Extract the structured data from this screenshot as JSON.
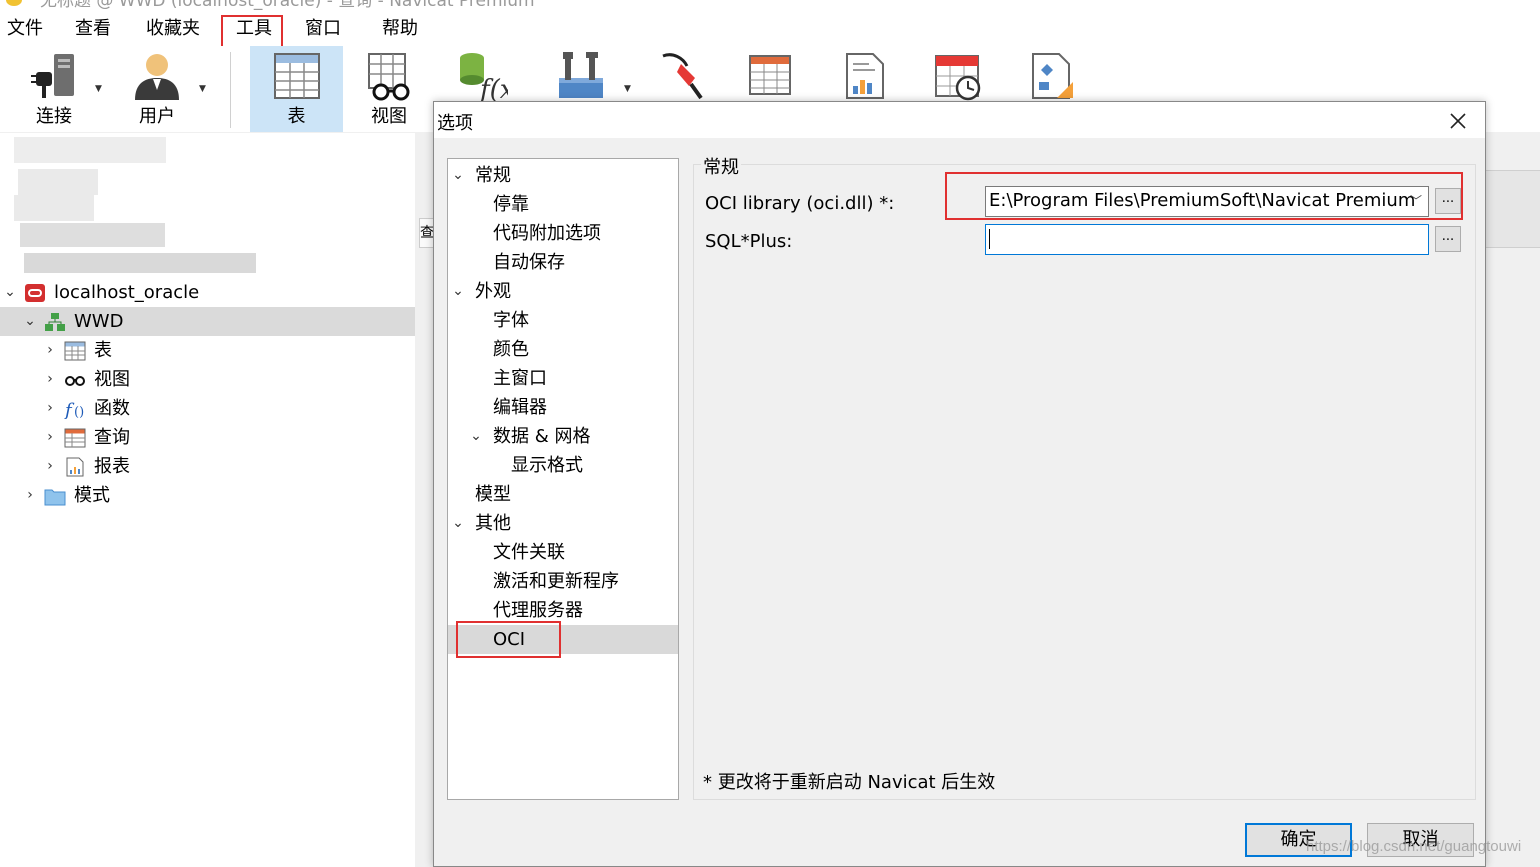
{
  "window": {
    "title": "无标题 @ WWD (localhost_oracle) - 查询 - Navicat Premium"
  },
  "menubar": {
    "items": [
      "文件",
      "查看",
      "收藏夹",
      "工具",
      "窗口",
      "帮助"
    ]
  },
  "toolbar": {
    "connect": "连接",
    "user": "用户",
    "table": "表",
    "view": "视图"
  },
  "navigator": {
    "connection": "localhost_oracle",
    "schema": "WWD",
    "children": [
      "表",
      "视图",
      "函数",
      "查询",
      "报表"
    ],
    "other": "模式"
  },
  "dialog": {
    "title": "选项",
    "tree": {
      "general": "常规",
      "dock": "停靠",
      "code_append": "代码附加选项",
      "autosave": "自动保存",
      "appearance": "外观",
      "font": "字体",
      "color": "颜色",
      "main_window": "主窗口",
      "editor": "编辑器",
      "data_grid": "数据 & 网格",
      "display_format": "显示格式",
      "model": "模型",
      "other": "其他",
      "file_assoc": "文件关联",
      "activate_update": "激活和更新程序",
      "proxy": "代理服务器",
      "oci": "OCI"
    },
    "group_title": "常规",
    "oci_label": "OCI library (oci.dll) *:",
    "oci_value": "E:\\Program Files\\PremiumSoft\\Navicat Premium",
    "sqlplus_label": "SQL*Plus:",
    "sqlplus_value": "",
    "browse": "...",
    "note": "* 更改将于重新启动 Navicat 后生效",
    "ok": "确定",
    "cancel": "取消"
  },
  "watermark": "https://blog.csdn.net/guangtouwi",
  "colors": {
    "highlight_box": "#e03030",
    "selection": "#d9d9d9",
    "toolbar_active": "#cce4f7",
    "focus": "#0078d7"
  }
}
